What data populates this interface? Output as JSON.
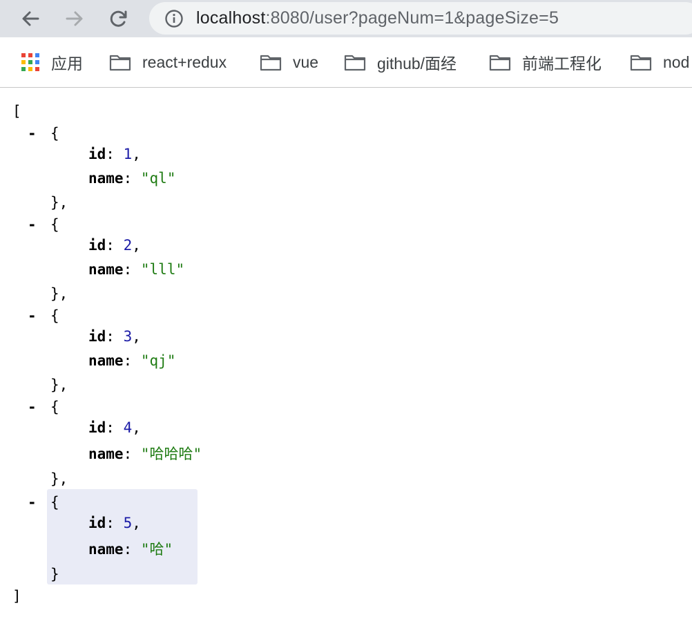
{
  "browser": {
    "url_host": "localhost",
    "url_rest": ":8080/user?pageNum=1&pageSize=5",
    "bookmarks": [
      {
        "label": "应用",
        "icon": "apps-grid-icon"
      },
      {
        "label": "react+redux",
        "icon": "folder-icon"
      },
      {
        "label": "vue",
        "icon": "folder-icon"
      },
      {
        "label": "github/面经",
        "icon": "folder-icon"
      },
      {
        "label": "前端工程化",
        "icon": "folder-icon"
      },
      {
        "label": "nod",
        "icon": "folder-icon"
      }
    ]
  },
  "json_view": {
    "open_bracket": "[",
    "close_bracket": "]",
    "collapse_glyph": "-",
    "items": [
      {
        "id": 1,
        "name": "ql"
      },
      {
        "id": 2,
        "name": "lll"
      },
      {
        "id": 3,
        "name": "qj"
      },
      {
        "id": 4,
        "name": "哈哈哈"
      },
      {
        "id": 5,
        "name": "哈"
      }
    ]
  },
  "colors": {
    "toolbar_bg": "#dee1e6",
    "number": "#1a1aa6",
    "string": "#1e7b12",
    "highlight": "#e9ebf6"
  }
}
